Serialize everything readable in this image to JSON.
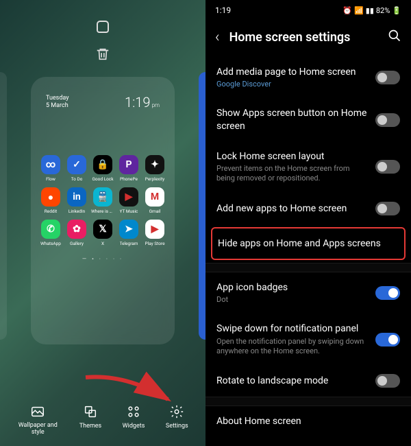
{
  "left": {
    "date_day": "Tuesday",
    "date_full": "5 March",
    "time": "1:19",
    "time_suffix": "pm",
    "apps": [
      {
        "label": "Flow",
        "bg": "#2968d8",
        "glyph": "∞"
      },
      {
        "label": "To Do",
        "bg": "#2968d8",
        "glyph": "✓"
      },
      {
        "label": "Good Lock",
        "bg": "#000",
        "glyph": "🔒"
      },
      {
        "label": "PhonePe",
        "bg": "#5f259f",
        "glyph": "P"
      },
      {
        "label": "Perplexity",
        "bg": "#111",
        "glyph": "✦"
      },
      {
        "label": "Reddit",
        "bg": "#ff4500",
        "glyph": "●"
      },
      {
        "label": "LinkedIn",
        "bg": "#0a66c2",
        "glyph": "in"
      },
      {
        "label": "Where is my..",
        "bg": "#0bb5d0",
        "glyph": "🚆"
      },
      {
        "label": "YT Music",
        "bg": "#111",
        "glyph": "▶"
      },
      {
        "label": "Gmail",
        "bg": "#fff",
        "glyph": "M"
      },
      {
        "label": "WhatsApp",
        "bg": "#25d366",
        "glyph": "✆"
      },
      {
        "label": "Gallery",
        "bg": "#e91e63",
        "glyph": "✿"
      },
      {
        "label": "X",
        "bg": "#000",
        "glyph": "𝕏"
      },
      {
        "label": "Telegram",
        "bg": "#0088cc",
        "glyph": "➤"
      },
      {
        "label": "Play Store",
        "bg": "#fff",
        "glyph": "▶"
      }
    ],
    "bottom": {
      "wallpaper": "Wallpaper and style",
      "themes": "Themes",
      "widgets": "Widgets",
      "settings": "Settings"
    }
  },
  "right": {
    "status_time": "1:19",
    "battery": "82%",
    "title": "Home screen settings",
    "items": [
      {
        "title": "Add media page to Home screen",
        "sub": "Google Discover",
        "subclass": "st-link",
        "toggle": "off"
      },
      {
        "title": "Show Apps screen button on Home screen",
        "toggle": "off"
      },
      {
        "title": "Lock Home screen layout",
        "sub": "Prevent items on the Home screen from being removed or repositioned.",
        "toggle": "off"
      },
      {
        "title": "Add new apps to Home screen",
        "toggle": "off"
      },
      {
        "title": "Hide apps on Home and Apps screens",
        "highlight": true
      },
      {
        "title": "App icon badges",
        "sub": "Dot",
        "toggle": "on"
      },
      {
        "title": "Swipe down for notification panel",
        "sub": "Open the notification panel by swiping down anywhere on the Home screen.",
        "toggle": "on"
      },
      {
        "title": "Rotate to landscape mode",
        "toggle": "off"
      },
      {
        "title": "About Home screen"
      }
    ]
  }
}
